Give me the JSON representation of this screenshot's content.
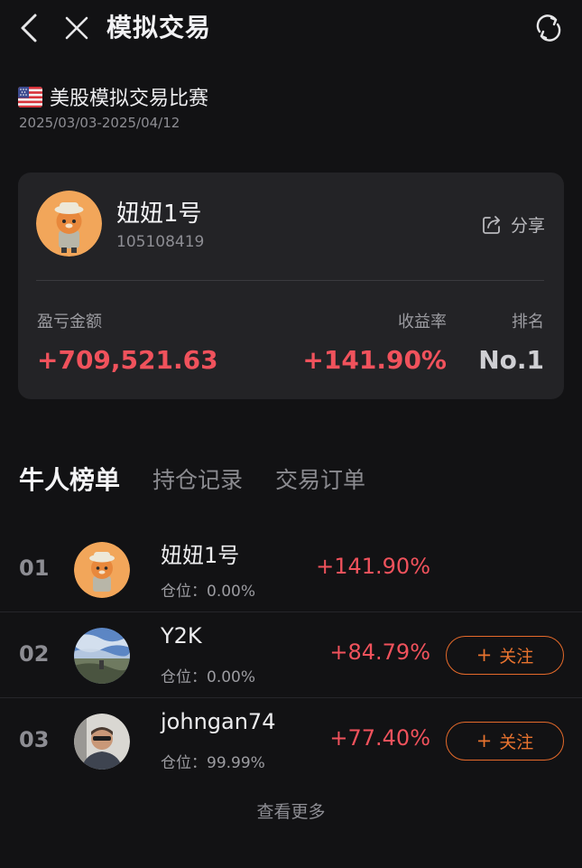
{
  "header": {
    "title": "模拟交易",
    "back_icon": "chevron-left-icon",
    "close_icon": "close-icon",
    "refresh_icon": "refresh-icon"
  },
  "competition": {
    "name": "美股模拟交易比赛",
    "dates": "2025/03/03-2025/04/12",
    "flag_icon": "us-flag-icon"
  },
  "card": {
    "username": "妞妞1号",
    "user_id": "105108419",
    "share_label": "分享",
    "pnl_label": "盈亏金额",
    "pnl_value": "+709,521.63",
    "rate_label": "收益率",
    "rate_value": "+141.90%",
    "rank_label": "排名",
    "rank_value": "No.1"
  },
  "tabs": [
    {
      "label": "牛人榜单",
      "active": true
    },
    {
      "label": "持仓记录",
      "active": false
    },
    {
      "label": "交易订单",
      "active": false
    }
  ],
  "leaderboard": [
    {
      "rank": "01",
      "name": "妞妞1号",
      "position_label": "仓位：",
      "position": "0.00%",
      "rate": "+141.90%",
      "follow_label": ""
    },
    {
      "rank": "02",
      "name": "Y2K",
      "position_label": "仓位：",
      "position": "0.00%",
      "rate": "+84.79%",
      "follow_label": "关注"
    },
    {
      "rank": "03",
      "name": "johngan74",
      "position_label": "仓位：",
      "position": "99.99%",
      "rate": "+77.40%",
      "follow_label": "关注"
    }
  ],
  "more_label": "查看更多",
  "colors": {
    "background": "#121214",
    "card": "#232326",
    "gain": "#F0525C",
    "follow": "#E8732F"
  }
}
